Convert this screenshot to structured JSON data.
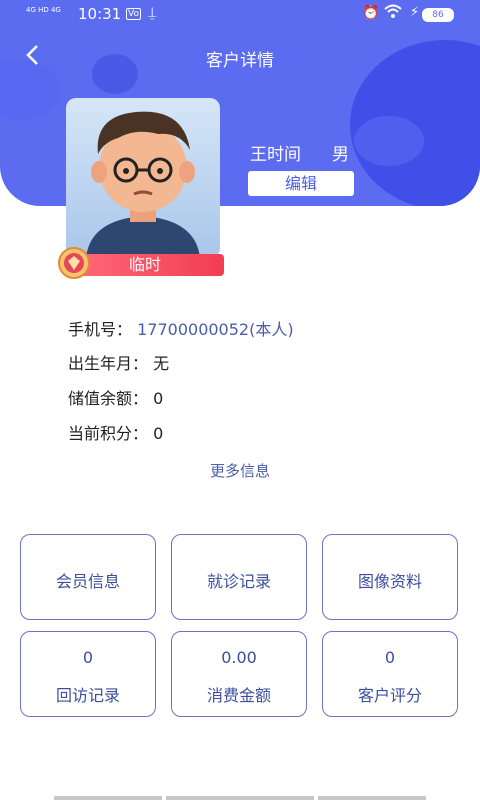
{
  "status_bar": {
    "signal": "4G HD 4G",
    "time": "10:31",
    "volte": "Vo",
    "usb_icon": "usb-icon",
    "alarm_icon": "alarm-icon",
    "wifi_icon": "wifi-icon",
    "battery": "86"
  },
  "header": {
    "back_icon": "back-arrow-icon",
    "title": "客户详情",
    "name": "王时间",
    "gender": "男",
    "edit_label": "编辑"
  },
  "avatar": {
    "badge_label": "临时",
    "medal_icon": "medal-icon"
  },
  "info": {
    "phone_label": "手机号：",
    "phone_value": "17700000052(本人)",
    "birth_label": "出生年月：",
    "birth_value": "无",
    "balance_label": "储值余额：",
    "balance_value": "0",
    "points_label": "当前积分：",
    "points_value": "0",
    "more_label": "更多信息"
  },
  "cards": {
    "member": "会员信息",
    "visit": "就诊记录",
    "images": "图像资料",
    "followup_count": "0",
    "followup": "回访记录",
    "spend_amount": "0.00",
    "spend": "消费金额",
    "rating_value": "0",
    "rating": "客户评分"
  }
}
